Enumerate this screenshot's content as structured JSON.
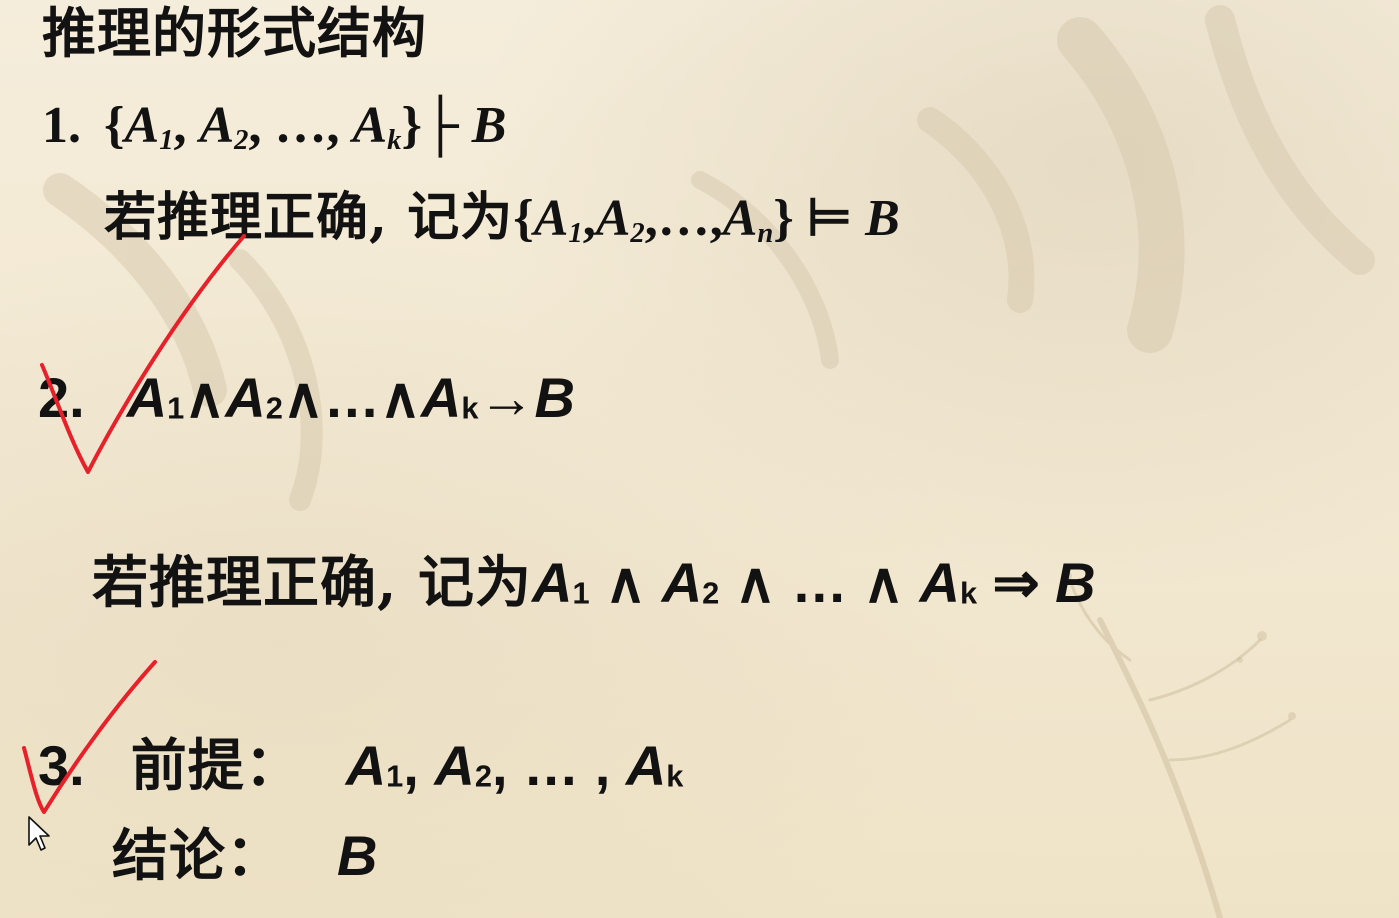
{
  "title": "推理的形式结构",
  "item1": {
    "num": "1.",
    "formula": "{A1, A2, …, Ak}├ B",
    "note_prefix": "若推理正确, 记为",
    "note_formula": "{A1,A2,…,An} ⊨ B"
  },
  "item2": {
    "num": "2.",
    "formula": "A1∧A2∧…∧Ak→B",
    "note_prefix": "若推理正确, 记为",
    "note_formula": "A1 ∧ A2 ∧ … ∧ Ak ⇒ B"
  },
  "item3": {
    "num": "3.",
    "premise_label": "前提：",
    "premise_formula": "A1, A2, … , Ak",
    "conclusion_label": "结论：",
    "conclusion_formula": "B"
  },
  "annotations": {
    "ink_color": "#e8202a",
    "marks": [
      "checkmark",
      "checkmark"
    ]
  },
  "icons": {
    "cursor": "mouse-pointer-icon"
  }
}
